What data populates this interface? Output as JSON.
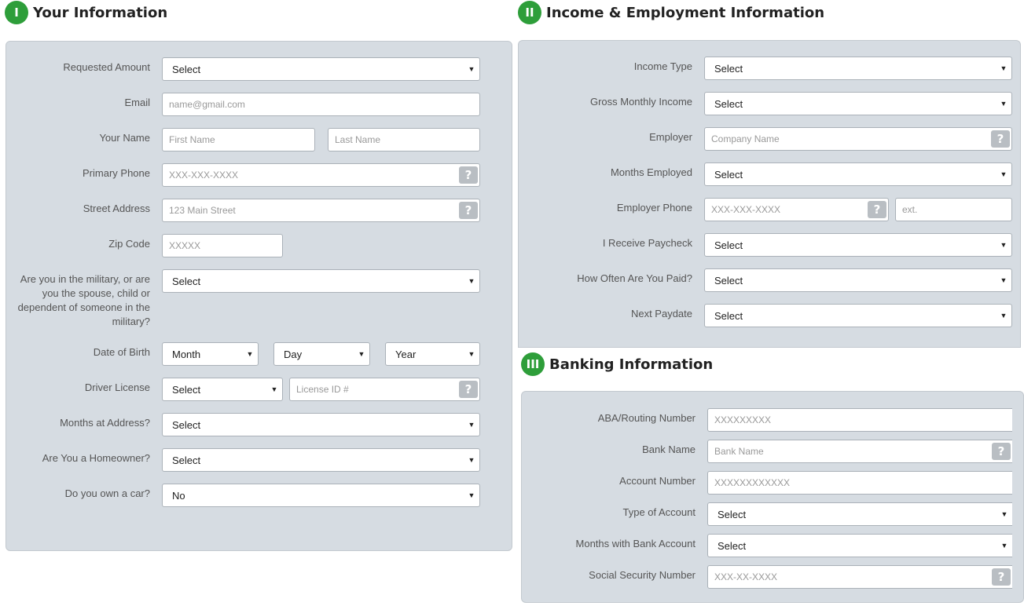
{
  "sections": {
    "your_info": {
      "badge": "I",
      "title": "Your Information",
      "requested_amount": {
        "label": "Requested Amount",
        "value": "Select"
      },
      "email": {
        "label": "Email",
        "placeholder": "name@gmail.com"
      },
      "name": {
        "label": "Your Name",
        "first_placeholder": "First Name",
        "last_placeholder": "Last Name"
      },
      "primary_phone": {
        "label": "Primary Phone",
        "placeholder": "XXX-XXX-XXXX"
      },
      "street": {
        "label": "Street Address",
        "placeholder": "123 Main Street"
      },
      "zip": {
        "label": "Zip Code",
        "placeholder": "XXXXX"
      },
      "military": {
        "label": "Are you in the military, or are you the spouse, child or dependent of someone in the military?",
        "value": "Select"
      },
      "dob": {
        "label": "Date of Birth",
        "month": "Month",
        "day": "Day",
        "year": "Year"
      },
      "license": {
        "label": "Driver License",
        "state_value": "Select",
        "id_placeholder": "License ID #"
      },
      "months_address": {
        "label": "Months at Address?",
        "value": "Select"
      },
      "homeowner": {
        "label": "Are You a Homeowner?",
        "value": "Select"
      },
      "car": {
        "label": "Do you own a car?",
        "value": "No"
      }
    },
    "income": {
      "badge": "II",
      "title": "Income & Employment Information",
      "income_type": {
        "label": "Income Type",
        "value": "Select"
      },
      "gross_income": {
        "label": "Gross Monthly Income",
        "value": "Select"
      },
      "employer": {
        "label": "Employer",
        "placeholder": "Company Name"
      },
      "months_employed": {
        "label": "Months Employed",
        "value": "Select"
      },
      "employer_phone": {
        "label": "Employer Phone",
        "placeholder": "XXX-XXX-XXXX",
        "ext_placeholder": "ext."
      },
      "paycheck": {
        "label": "I Receive Paycheck",
        "value": "Select"
      },
      "pay_frequency": {
        "label": "How Often Are You Paid?",
        "value": "Select"
      },
      "next_paydate": {
        "label": "Next Paydate",
        "value": "Select"
      }
    },
    "banking": {
      "badge": "III",
      "title": "Banking Information",
      "routing": {
        "label": "ABA/Routing Number",
        "placeholder": "XXXXXXXXX"
      },
      "bank_name": {
        "label": "Bank Name",
        "placeholder": "Bank Name"
      },
      "account_number": {
        "label": "Account Number",
        "placeholder": "XXXXXXXXXXXX"
      },
      "account_type": {
        "label": "Type of Account",
        "value": "Select"
      },
      "months_bank": {
        "label": "Months with Bank Account",
        "value": "Select"
      },
      "ssn": {
        "label": "Social Security Number",
        "placeholder": "XXX-XX-XXXX"
      }
    }
  },
  "help_glyph": "?",
  "caret_glyph": "▼",
  "colors": {
    "badge": "#2e9e3a",
    "panel": "#d6dce2",
    "help": "#b9bec3"
  }
}
